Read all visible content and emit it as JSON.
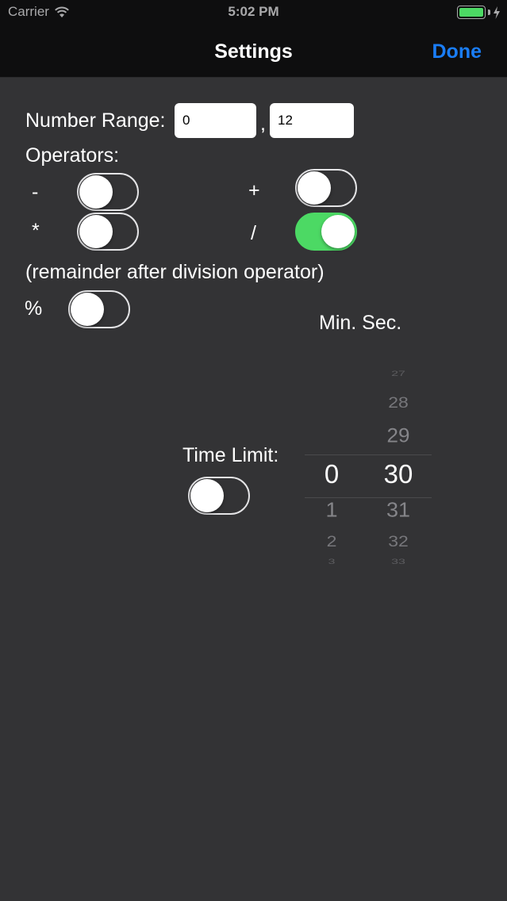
{
  "status_bar": {
    "carrier": "Carrier",
    "time": "5:02 PM",
    "battery_color": "#4cd964"
  },
  "nav": {
    "title": "Settings",
    "done_label": "Done",
    "accent_color": "#1a7df6"
  },
  "number_range": {
    "label": "Number Range:",
    "min_value": "0",
    "separator": ",",
    "max_value": "12"
  },
  "operators": {
    "label": "Operators:",
    "items": [
      {
        "symbol": "-",
        "enabled": false
      },
      {
        "symbol": "+",
        "enabled": false
      },
      {
        "symbol": "*",
        "enabled": false
      },
      {
        "symbol": "/",
        "enabled": true
      }
    ],
    "remainder_note": "(remainder after division operator)",
    "modulo": {
      "symbol": "%",
      "enabled": false
    }
  },
  "time_limit": {
    "label": "Time Limit:",
    "enabled": false,
    "picker_header": "Min. Sec.",
    "minutes": {
      "above": [],
      "selected": "0",
      "below": [
        "1",
        "2",
        "3"
      ]
    },
    "seconds": {
      "above": [
        "27",
        "28",
        "29"
      ],
      "selected": "30",
      "below": [
        "31",
        "32",
        "33"
      ]
    }
  }
}
